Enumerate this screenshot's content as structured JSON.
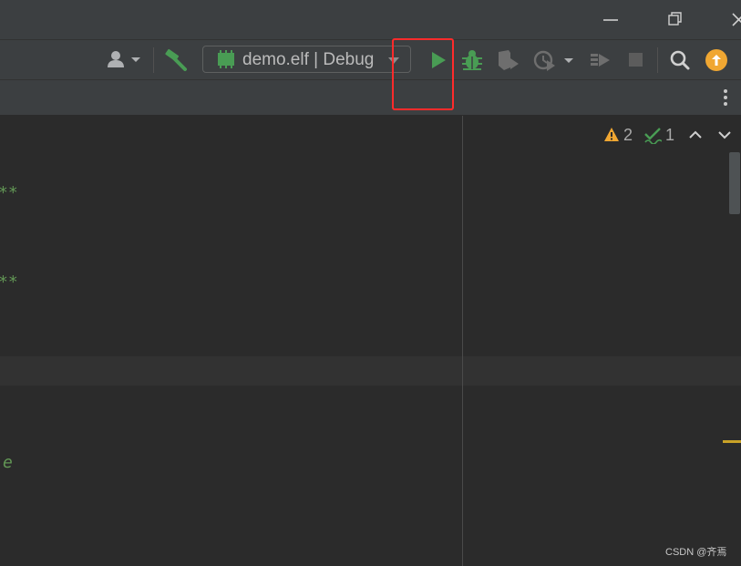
{
  "window_controls": {
    "minimize_icon": "minimize-icon",
    "restore_icon": "restore-icon",
    "close_icon": "close-icon"
  },
  "toolbar": {
    "run_config_label": "demo.elf | Debug",
    "icons": [
      "user-icon",
      "hammer-build-icon",
      "chip-icon",
      "run-icon",
      "debug-bug-icon",
      "coverage-icon",
      "profile-icon",
      "attach-icon",
      "stop-icon",
      "search-icon",
      "update-icon"
    ],
    "colors": {
      "run": "#499c54",
      "update": "#f0a732",
      "highlight": "#ff2b2b"
    }
  },
  "tabbar": {
    "more_icon": "more-vertical-icon"
  },
  "editor": {
    "code_fragments": [
      "**",
      "**",
      "e"
    ],
    "inspections": {
      "warnings": "2",
      "weak_warnings": "1"
    }
  },
  "watermark": "CSDN @齐焉"
}
